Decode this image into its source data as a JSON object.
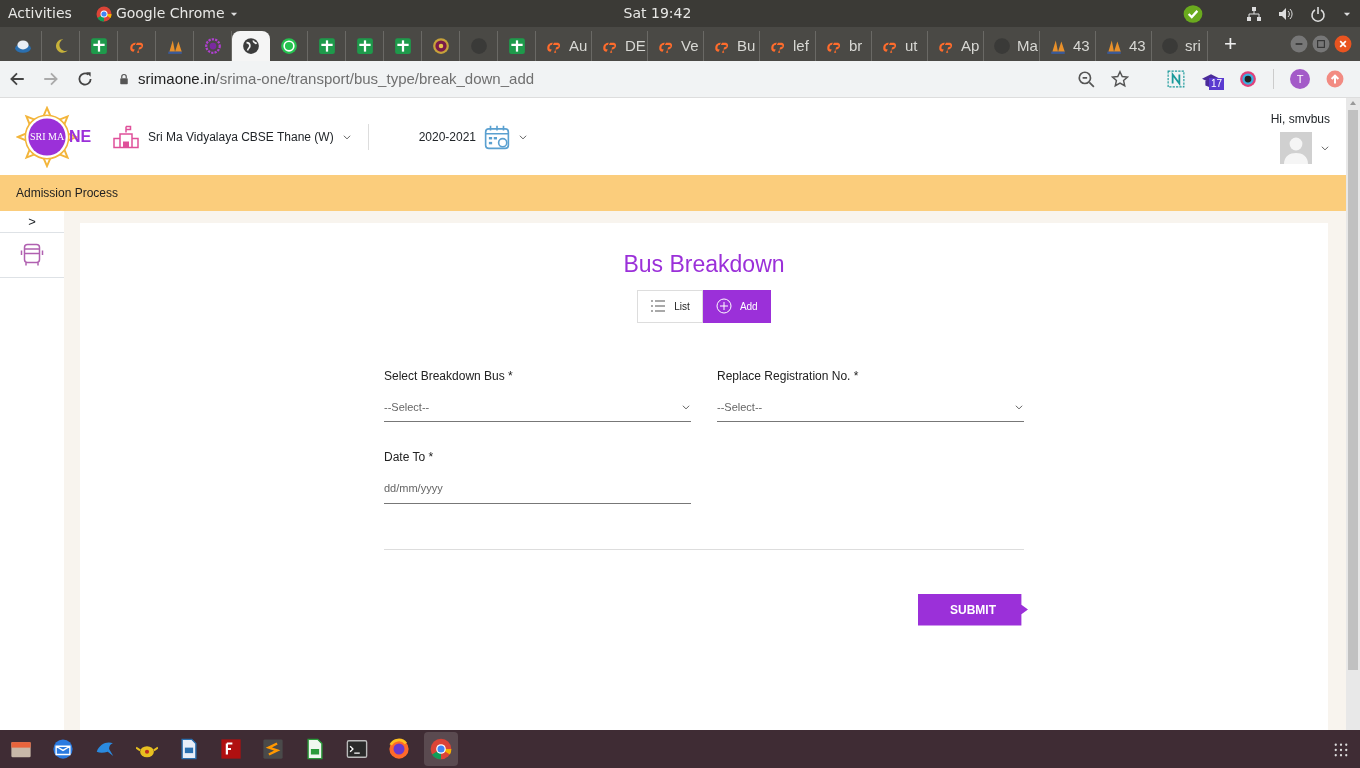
{
  "top_bar": {
    "activities": "Activities",
    "app": "Google Chrome",
    "clock": "Sat 19:42"
  },
  "tabs": [
    {
      "kind": "disk",
      "selected": false
    },
    {
      "kind": "moon",
      "selected": false
    },
    {
      "kind": "sheet",
      "selected": false
    },
    {
      "kind": "cpanel",
      "selected": false
    },
    {
      "kind": "sail",
      "selected": false
    },
    {
      "kind": "flower",
      "selected": false
    },
    {
      "kind": "globe",
      "selected": true
    },
    {
      "kind": "chat",
      "selected": false
    },
    {
      "kind": "sheet",
      "selected": false
    },
    {
      "kind": "sheet",
      "selected": false
    },
    {
      "kind": "sheet",
      "selected": false
    },
    {
      "kind": "coin",
      "selected": false
    },
    {
      "kind": "blank",
      "selected": false
    },
    {
      "kind": "sheet",
      "selected": false
    },
    {
      "kind": "cpanel",
      "label": "Au",
      "selected": false
    },
    {
      "kind": "cpanel",
      "label": "DE",
      "selected": false
    },
    {
      "kind": "cpanel",
      "label": "Ve",
      "selected": false
    },
    {
      "kind": "cpanel",
      "label": "Bu",
      "selected": false
    },
    {
      "kind": "cpanel",
      "label": "lef",
      "selected": false
    },
    {
      "kind": "cpanel",
      "label": "br",
      "selected": false
    },
    {
      "kind": "cpanel",
      "label": "ut",
      "selected": false
    },
    {
      "kind": "cpanel",
      "label": "Ap",
      "selected": false
    },
    {
      "kind": "blank",
      "label": "Ma",
      "selected": false
    },
    {
      "kind": "sail",
      "label": "43",
      "selected": false
    },
    {
      "kind": "sail",
      "label": "43",
      "selected": false
    },
    {
      "kind": "blank",
      "label": "sri",
      "selected": false
    }
  ],
  "new_tab": "+",
  "address_bar": {
    "host": "srimaone.in",
    "path": "/srima-one/transport/bus_type/break_down_add"
  },
  "extension_badge": "17",
  "profile_initial": "T",
  "header": {
    "logo_text": "SRI MA",
    "logo_suffix": "NE",
    "school": "Sri Ma Vidyalaya CBSE Thane (W)",
    "year": "2020-2021",
    "greeting": "Hi, smvbus"
  },
  "menu_bar": {
    "items": [
      "Admission Process"
    ]
  },
  "sidebar": {
    "toggle": ">"
  },
  "page": {
    "title": "Bus Breakdown",
    "view_buttons": [
      {
        "kind": "list",
        "label": "List",
        "selected": false
      },
      {
        "kind": "add",
        "label": "Add",
        "selected": true
      }
    ],
    "fields": [
      {
        "kind": "select",
        "label": "Select Breakdown Bus *",
        "placeholder": "--Select--"
      },
      {
        "kind": "select",
        "label": "Replace Registration No. *",
        "placeholder": "--Select--"
      },
      {
        "kind": "date",
        "label": "Date To *",
        "placeholder": "dd/mm/yyyy"
      }
    ],
    "submit": "SUBMIT"
  }
}
